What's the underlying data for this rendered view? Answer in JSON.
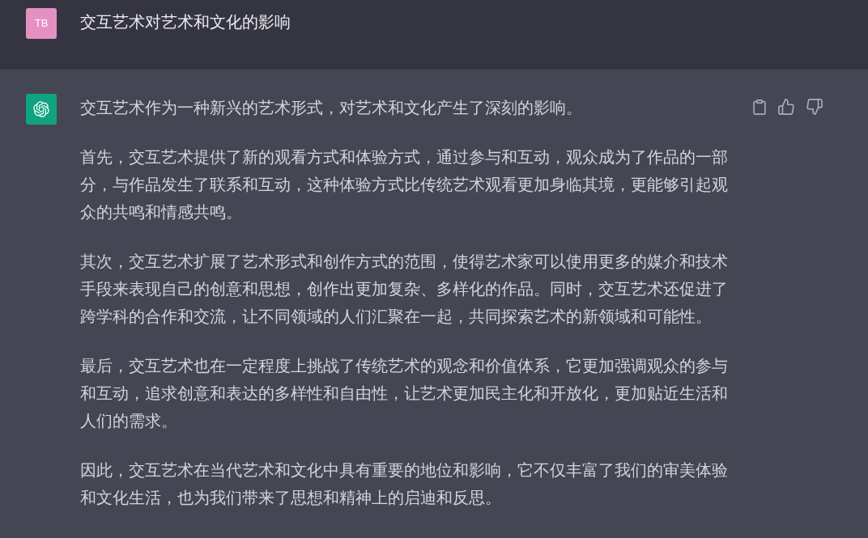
{
  "messages": [
    {
      "kind": "user",
      "avatar": "TB",
      "text": "交互艺术对艺术和文化的影响"
    },
    {
      "kind": "assistant",
      "paragraphs": [
        "交互艺术作为一种新兴的艺术形式，对艺术和文化产生了深刻的影响。",
        "首先，交互艺术提供了新的观看方式和体验方式，通过参与和互动，观众成为了作品的一部分，与作品发生了联系和互动，这种体验方式比传统艺术观看更加身临其境，更能够引起观众的共鸣和情感共鸣。",
        "其次，交互艺术扩展了艺术形式和创作方式的范围，使得艺术家可以使用更多的媒介和技术手段来表现自己的创意和思想，创作出更加复杂、多样化的作品。同时，交互艺术还促进了跨学科的合作和交流，让不同领域的人们汇聚在一起，共同探索艺术的新领域和可能性。",
        "最后，交互艺术也在一定程度上挑战了传统艺术的观念和价值体系，它更加强调观众的参与和互动，追求创意和表达的多样性和自由性，让艺术更加民主化和开放化，更加贴近生活和人们的需求。",
        "因此，交互艺术在当代艺术和文化中具有重要的地位和影响，它不仅丰富了我们的审美体验和文化生活，也为我们带来了思想和精神上的启迪和反思。"
      ]
    }
  ]
}
